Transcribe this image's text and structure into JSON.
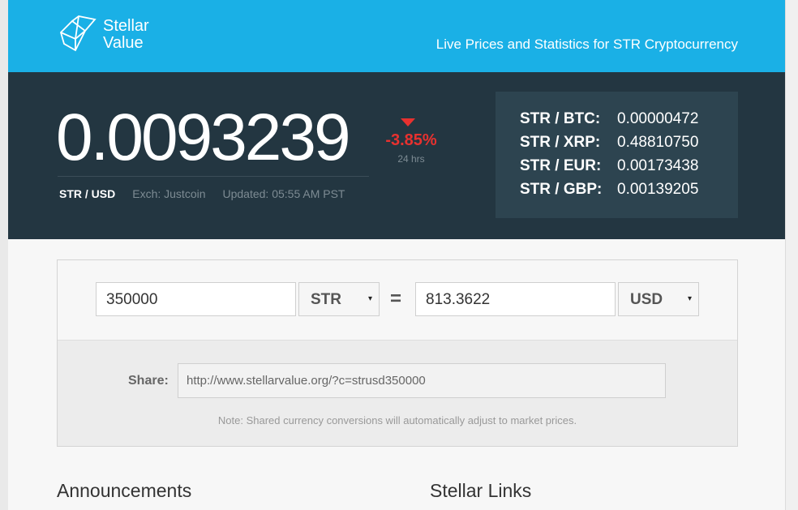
{
  "header": {
    "brand_line1": "Stellar",
    "brand_line2": "Value",
    "tagline": "Live Prices and Statistics for STR Cryptocurrency"
  },
  "ticker": {
    "price": "0.0093239",
    "change": "-3.85%",
    "change_period": "24 hrs",
    "pair": "STR / USD",
    "exchange": "Exch: Justcoin",
    "updated": "Updated: 05:55 AM PST"
  },
  "rates": [
    {
      "label": "STR / BTC:",
      "value": "0.00000472"
    },
    {
      "label": "STR / XRP:",
      "value": "0.48810750"
    },
    {
      "label": "STR / EUR:",
      "value": "0.00173438"
    },
    {
      "label": "STR / GBP:",
      "value": "0.00139205"
    }
  ],
  "converter": {
    "from_amount": "350000",
    "from_currency": "STR",
    "equals": "=",
    "to_amount": "813.3622",
    "to_currency": "USD",
    "caret": "▾"
  },
  "share": {
    "label": "Share:",
    "url": "http://www.stellarvalue.org/?c=strusd350000",
    "note": "Note: Shared currency conversions will automatically adjust to market prices."
  },
  "sections": {
    "announcements": "Announcements",
    "links": "Stellar Links"
  },
  "colors": {
    "header_bg": "#1ab0e6",
    "band_bg": "#233641",
    "rates_bg": "#2d4450",
    "negative": "#e8312f"
  }
}
